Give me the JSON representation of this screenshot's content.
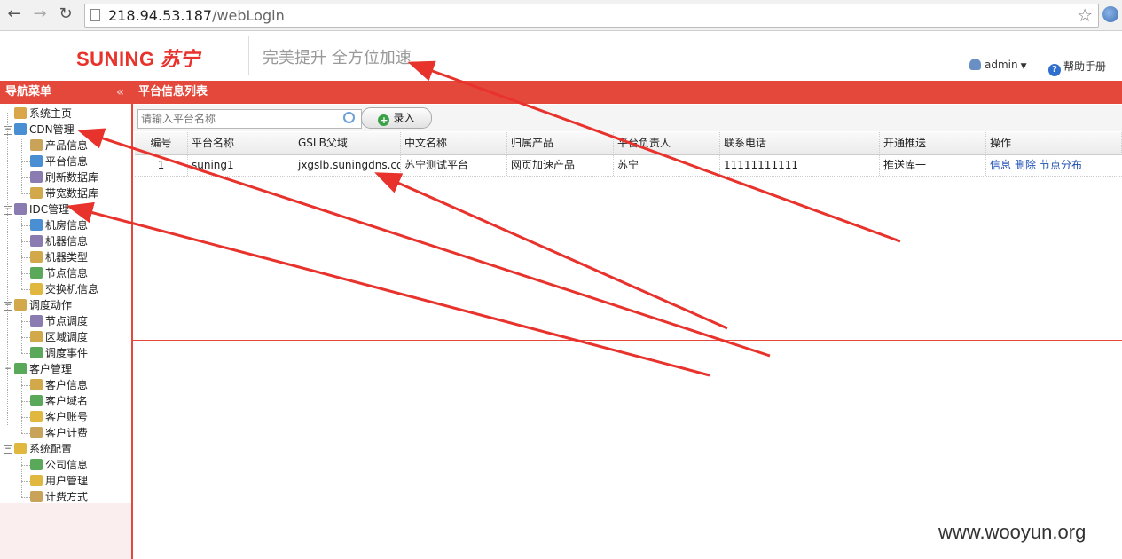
{
  "browser": {
    "url_host": "218.94.53.187",
    "url_path": "/webLogin"
  },
  "header": {
    "logo_text": "SUNING",
    "logo_cn": "苏宁",
    "slogan": "完美提升 全方位加速",
    "user": "admin",
    "help": "帮助手册"
  },
  "sidebar": {
    "title": "导航菜单",
    "collapse_glyph": "«",
    "home": "系统主页",
    "groups": [
      {
        "label": "CDN管理",
        "items": [
          "产品信息",
          "平台信息",
          "刷新数据库",
          "带宽数据库"
        ]
      },
      {
        "label": "IDC管理",
        "items": [
          "机房信息",
          "机器信息",
          "机器类型",
          "节点信息",
          "交换机信息"
        ]
      },
      {
        "label": "调度动作",
        "items": [
          "节点调度",
          "区域调度",
          "调度事件"
        ]
      },
      {
        "label": "客户管理",
        "items": [
          "客户信息",
          "客户域名",
          "客户账号",
          "客户计费"
        ]
      },
      {
        "label": "系统配置",
        "items": [
          "公司信息",
          "用户管理",
          "计费方式"
        ]
      }
    ]
  },
  "main": {
    "title": "平台信息列表",
    "search_placeholder": "请输入平台名称",
    "add_label": "录入",
    "columns": [
      "编号",
      "平台名称",
      "GSLB父域",
      "中文名称",
      "归属产品",
      "平台负责人",
      "联系电话",
      "开通推送",
      "操作"
    ],
    "rows": [
      {
        "id": "1",
        "platform": "suning1",
        "gslb": "jxgslb.suningdns.com",
        "cn_name": "苏宁测试平台",
        "product": "网页加速产品",
        "owner": "苏宁",
        "phone": "11111111111",
        "push": "推送库一",
        "ops": [
          "信息",
          "删除",
          "节点分布"
        ]
      }
    ]
  },
  "watermark": "www.wooyun.org",
  "colors": {
    "accent": "#e3483a",
    "annotation": "#e8322c",
    "link": "#1f4fb3"
  }
}
